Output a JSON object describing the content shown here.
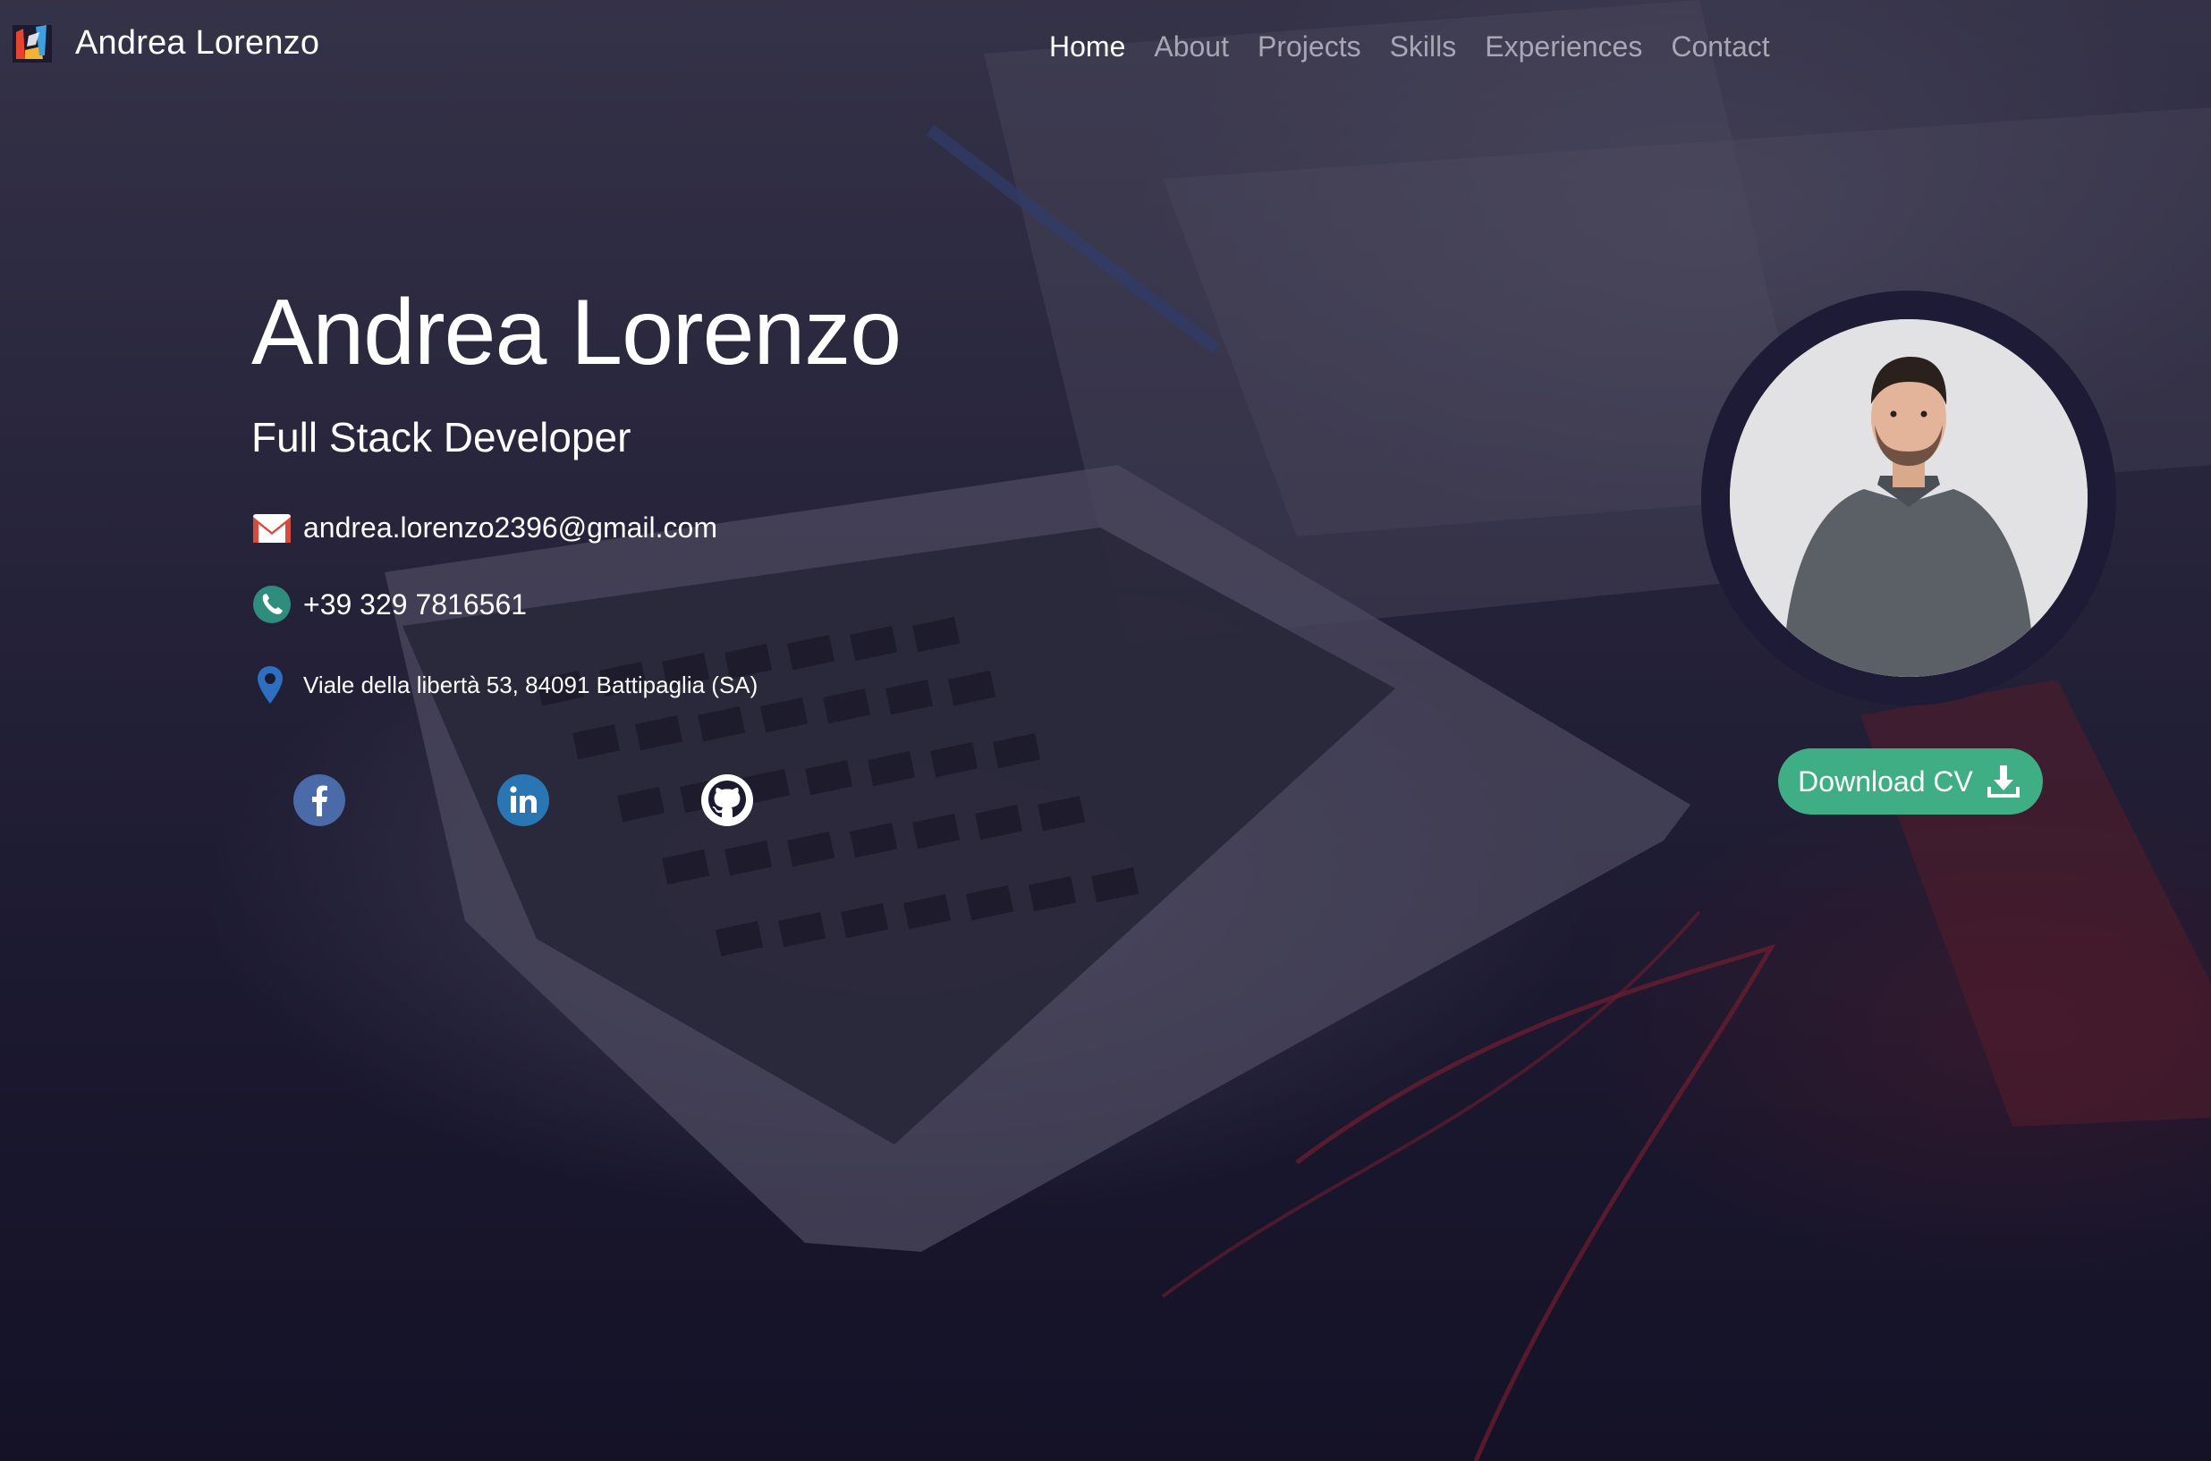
{
  "brand": {
    "name": "Andrea Lorenzo",
    "logo_icon": "brand-logo-icon"
  },
  "nav": {
    "items": [
      {
        "label": "Home",
        "active": true
      },
      {
        "label": "About",
        "active": false
      },
      {
        "label": "Projects",
        "active": false
      },
      {
        "label": "Skills",
        "active": false
      },
      {
        "label": "Experiences",
        "active": false
      },
      {
        "label": "Contact",
        "active": false
      }
    ]
  },
  "hero": {
    "name": "Andrea Lorenzo",
    "role": "Full Stack Developer",
    "email": "andrea.lorenzo2396@gmail.com",
    "phone": "+39 329 7816561",
    "address": "Viale della libertà 53, 84091 Battipaglia (SA)"
  },
  "socials": [
    {
      "name": "facebook",
      "icon": "facebook-icon",
      "color": "#4a6aa8"
    },
    {
      "name": "linkedin",
      "icon": "linkedin-icon",
      "color": "#2a76b4"
    },
    {
      "name": "github",
      "icon": "github-icon",
      "color": "#ffffff"
    }
  ],
  "cv": {
    "label": "Download CV",
    "icon": "download-icon",
    "color": "#3fae85"
  },
  "colors": {
    "overlay": "#1c1a30",
    "avatar_ring": "#1e1b36",
    "text": "#ffffff",
    "nav_inactive": "#a8a6b4"
  }
}
